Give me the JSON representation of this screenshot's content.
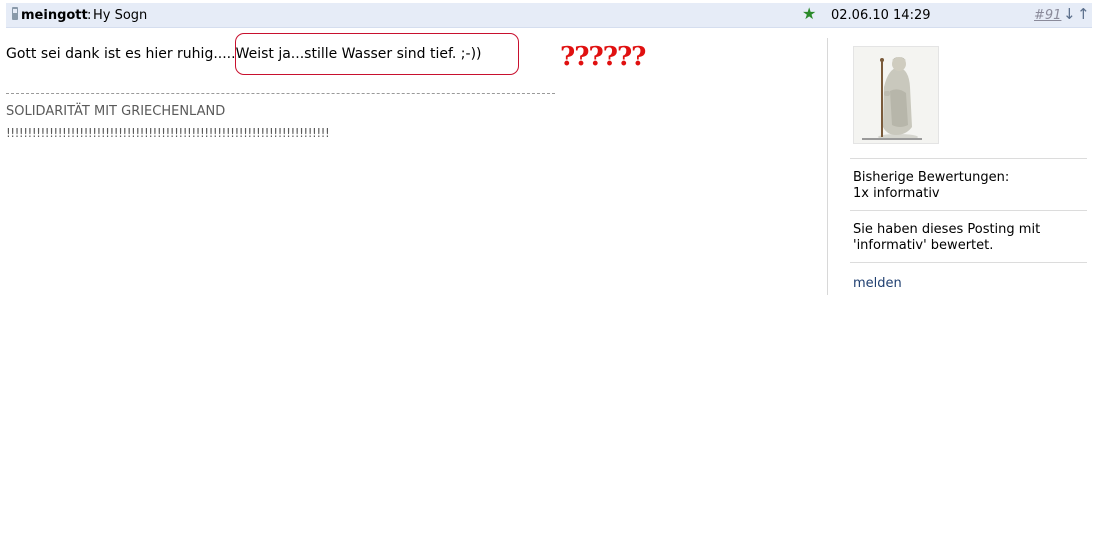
{
  "header": {
    "username": "meingott",
    "separator": ":",
    "title": "Hy Sogn",
    "date": "02.06.10 14:29",
    "post_number": "#91",
    "arrow_down": "↓",
    "arrow_up": "↑",
    "star": "★"
  },
  "post": {
    "text": "Gott sei dank ist es hier ruhig.....Weist ja...stille Wasser sind tief. ;-))",
    "question_marks": "??????",
    "signature_line1": "SOLIDARITÄT MIT GRIECHENLAND",
    "signature_line2": "!!!!!!!!!!!!!!!!!!!!!!!!!!!!!!!!!!!!!!!!!!!!!!!!!!!!!!!!!!!!!!!!!!!!!!!!!!!"
  },
  "sidebar": {
    "ratings_label": "Bisherige Bewertungen:",
    "ratings_value": "1x informativ",
    "rated_note_line1": "Sie haben dieses Posting mit",
    "rated_note_line2": "'informativ' bewertet.",
    "report_link": "melden"
  },
  "colors": {
    "header_bg": "#e6ecf7",
    "bubble_border": "#c8102e",
    "question_marks": "#e01010",
    "link": "#1f3f70"
  },
  "icons": [
    "phone-icon",
    "star-icon",
    "arrow-down-icon",
    "arrow-up-icon"
  ]
}
